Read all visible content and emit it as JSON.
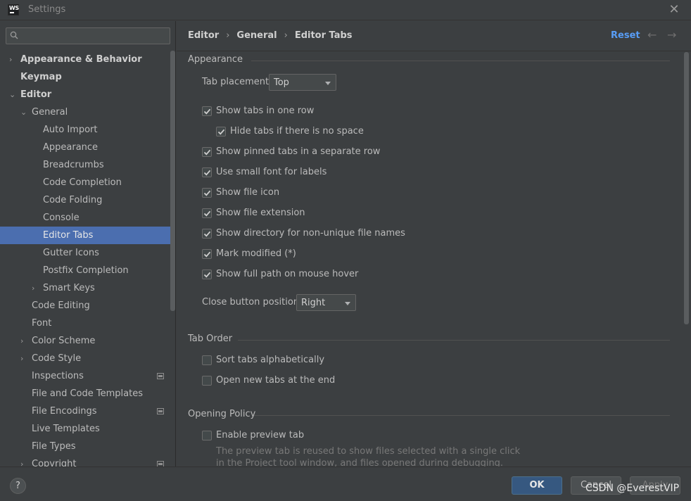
{
  "window": {
    "title": "Settings",
    "app_icon_text": "WS",
    "accent": "#4b6eaf"
  },
  "search": {
    "placeholder": ""
  },
  "tree": [
    {
      "label": "Appearance & Behavior",
      "chevron": "›",
      "selected": false
    },
    {
      "label": "Keymap",
      "chevron": "",
      "selected": false
    },
    {
      "label": "Editor",
      "chevron": "⌄",
      "selected": false
    },
    {
      "label": "General",
      "chevron": "⌄",
      "selected": false
    },
    {
      "label": "Auto Import",
      "chevron": "",
      "selected": false
    },
    {
      "label": "Appearance",
      "chevron": "",
      "selected": false
    },
    {
      "label": "Breadcrumbs",
      "chevron": "",
      "selected": false
    },
    {
      "label": "Code Completion",
      "chevron": "",
      "selected": false
    },
    {
      "label": "Code Folding",
      "chevron": "",
      "selected": false
    },
    {
      "label": "Console",
      "chevron": "",
      "selected": false
    },
    {
      "label": "Editor Tabs",
      "chevron": "",
      "selected": true
    },
    {
      "label": "Gutter Icons",
      "chevron": "",
      "selected": false
    },
    {
      "label": "Postfix Completion",
      "chevron": "",
      "selected": false
    },
    {
      "label": "Smart Keys",
      "chevron": "›",
      "selected": false
    },
    {
      "label": "Code Editing",
      "chevron": "",
      "selected": false
    },
    {
      "label": "Font",
      "chevron": "",
      "selected": false
    },
    {
      "label": "Color Scheme",
      "chevron": "›",
      "selected": false
    },
    {
      "label": "Code Style",
      "chevron": "›",
      "selected": false
    },
    {
      "label": "Inspections",
      "chevron": "",
      "selected": false
    },
    {
      "label": "File and Code Templates",
      "chevron": "",
      "selected": false
    },
    {
      "label": "File Encodings",
      "chevron": "",
      "selected": false
    },
    {
      "label": "Live Templates",
      "chevron": "",
      "selected": false
    },
    {
      "label": "File Types",
      "chevron": "",
      "selected": false
    },
    {
      "label": "Copyright",
      "chevron": "›",
      "selected": false
    }
  ],
  "breadcrumb": [
    "Editor",
    "General",
    "Editor Tabs"
  ],
  "header": {
    "reset": "Reset",
    "back_icon": "←",
    "forward_icon": "→"
  },
  "sections": {
    "appearance": "Appearance",
    "tab_order": "Tab Order",
    "opening_policy": "Opening Policy"
  },
  "tab_placement": {
    "label": "Tab placement:",
    "value": "Top"
  },
  "appearance_options": [
    {
      "label": "Show tabs in one row",
      "checked": true
    },
    {
      "label": "Hide tabs if there is no space",
      "checked": true
    },
    {
      "label": "Show pinned tabs in a separate row",
      "checked": true
    },
    {
      "label": "Use small font for labels",
      "checked": true
    },
    {
      "label": "Show file icon",
      "checked": true
    },
    {
      "label": "Show file extension",
      "checked": true
    },
    {
      "label": "Show directory for non-unique file names",
      "checked": true
    },
    {
      "label": "Mark modified (*)",
      "checked": true
    },
    {
      "label": "Show full path on mouse hover",
      "checked": true
    }
  ],
  "close_button": {
    "label": "Close button position:",
    "value": "Right"
  },
  "tab_order_options": [
    {
      "label": "Sort tabs alphabetically",
      "checked": false
    },
    {
      "label": "Open new tabs at the end",
      "checked": false
    }
  ],
  "opening_policy_options": [
    {
      "label": "Enable preview tab",
      "checked": false
    }
  ],
  "preview_hint": [
    "The preview tab is reused to show files selected with a single click",
    "in the Project tool window, and files opened during debugging."
  ],
  "footer": {
    "help": "?",
    "ok": "OK",
    "cancel": "Cancel",
    "apply": "Apply"
  },
  "watermark": "CSDN @EverestVIP"
}
